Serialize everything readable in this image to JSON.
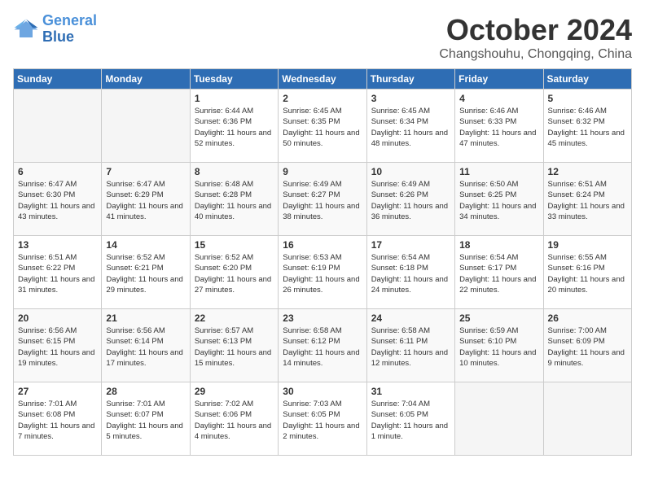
{
  "header": {
    "logo_line1": "General",
    "logo_line2": "Blue",
    "month": "October 2024",
    "location": "Changshouhu, Chongqing, China"
  },
  "weekdays": [
    "Sunday",
    "Monday",
    "Tuesday",
    "Wednesday",
    "Thursday",
    "Friday",
    "Saturday"
  ],
  "weeks": [
    [
      {
        "day": "",
        "info": ""
      },
      {
        "day": "",
        "info": ""
      },
      {
        "day": "1",
        "info": "Sunrise: 6:44 AM\nSunset: 6:36 PM\nDaylight: 11 hours and 52 minutes."
      },
      {
        "day": "2",
        "info": "Sunrise: 6:45 AM\nSunset: 6:35 PM\nDaylight: 11 hours and 50 minutes."
      },
      {
        "day": "3",
        "info": "Sunrise: 6:45 AM\nSunset: 6:34 PM\nDaylight: 11 hours and 48 minutes."
      },
      {
        "day": "4",
        "info": "Sunrise: 6:46 AM\nSunset: 6:33 PM\nDaylight: 11 hours and 47 minutes."
      },
      {
        "day": "5",
        "info": "Sunrise: 6:46 AM\nSunset: 6:32 PM\nDaylight: 11 hours and 45 minutes."
      }
    ],
    [
      {
        "day": "6",
        "info": "Sunrise: 6:47 AM\nSunset: 6:30 PM\nDaylight: 11 hours and 43 minutes."
      },
      {
        "day": "7",
        "info": "Sunrise: 6:47 AM\nSunset: 6:29 PM\nDaylight: 11 hours and 41 minutes."
      },
      {
        "day": "8",
        "info": "Sunrise: 6:48 AM\nSunset: 6:28 PM\nDaylight: 11 hours and 40 minutes."
      },
      {
        "day": "9",
        "info": "Sunrise: 6:49 AM\nSunset: 6:27 PM\nDaylight: 11 hours and 38 minutes."
      },
      {
        "day": "10",
        "info": "Sunrise: 6:49 AM\nSunset: 6:26 PM\nDaylight: 11 hours and 36 minutes."
      },
      {
        "day": "11",
        "info": "Sunrise: 6:50 AM\nSunset: 6:25 PM\nDaylight: 11 hours and 34 minutes."
      },
      {
        "day": "12",
        "info": "Sunrise: 6:51 AM\nSunset: 6:24 PM\nDaylight: 11 hours and 33 minutes."
      }
    ],
    [
      {
        "day": "13",
        "info": "Sunrise: 6:51 AM\nSunset: 6:22 PM\nDaylight: 11 hours and 31 minutes."
      },
      {
        "day": "14",
        "info": "Sunrise: 6:52 AM\nSunset: 6:21 PM\nDaylight: 11 hours and 29 minutes."
      },
      {
        "day": "15",
        "info": "Sunrise: 6:52 AM\nSunset: 6:20 PM\nDaylight: 11 hours and 27 minutes."
      },
      {
        "day": "16",
        "info": "Sunrise: 6:53 AM\nSunset: 6:19 PM\nDaylight: 11 hours and 26 minutes."
      },
      {
        "day": "17",
        "info": "Sunrise: 6:54 AM\nSunset: 6:18 PM\nDaylight: 11 hours and 24 minutes."
      },
      {
        "day": "18",
        "info": "Sunrise: 6:54 AM\nSunset: 6:17 PM\nDaylight: 11 hours and 22 minutes."
      },
      {
        "day": "19",
        "info": "Sunrise: 6:55 AM\nSunset: 6:16 PM\nDaylight: 11 hours and 20 minutes."
      }
    ],
    [
      {
        "day": "20",
        "info": "Sunrise: 6:56 AM\nSunset: 6:15 PM\nDaylight: 11 hours and 19 minutes."
      },
      {
        "day": "21",
        "info": "Sunrise: 6:56 AM\nSunset: 6:14 PM\nDaylight: 11 hours and 17 minutes."
      },
      {
        "day": "22",
        "info": "Sunrise: 6:57 AM\nSunset: 6:13 PM\nDaylight: 11 hours and 15 minutes."
      },
      {
        "day": "23",
        "info": "Sunrise: 6:58 AM\nSunset: 6:12 PM\nDaylight: 11 hours and 14 minutes."
      },
      {
        "day": "24",
        "info": "Sunrise: 6:58 AM\nSunset: 6:11 PM\nDaylight: 11 hours and 12 minutes."
      },
      {
        "day": "25",
        "info": "Sunrise: 6:59 AM\nSunset: 6:10 PM\nDaylight: 11 hours and 10 minutes."
      },
      {
        "day": "26",
        "info": "Sunrise: 7:00 AM\nSunset: 6:09 PM\nDaylight: 11 hours and 9 minutes."
      }
    ],
    [
      {
        "day": "27",
        "info": "Sunrise: 7:01 AM\nSunset: 6:08 PM\nDaylight: 11 hours and 7 minutes."
      },
      {
        "day": "28",
        "info": "Sunrise: 7:01 AM\nSunset: 6:07 PM\nDaylight: 11 hours and 5 minutes."
      },
      {
        "day": "29",
        "info": "Sunrise: 7:02 AM\nSunset: 6:06 PM\nDaylight: 11 hours and 4 minutes."
      },
      {
        "day": "30",
        "info": "Sunrise: 7:03 AM\nSunset: 6:05 PM\nDaylight: 11 hours and 2 minutes."
      },
      {
        "day": "31",
        "info": "Sunrise: 7:04 AM\nSunset: 6:05 PM\nDaylight: 11 hours and 1 minute."
      },
      {
        "day": "",
        "info": ""
      },
      {
        "day": "",
        "info": ""
      }
    ]
  ]
}
